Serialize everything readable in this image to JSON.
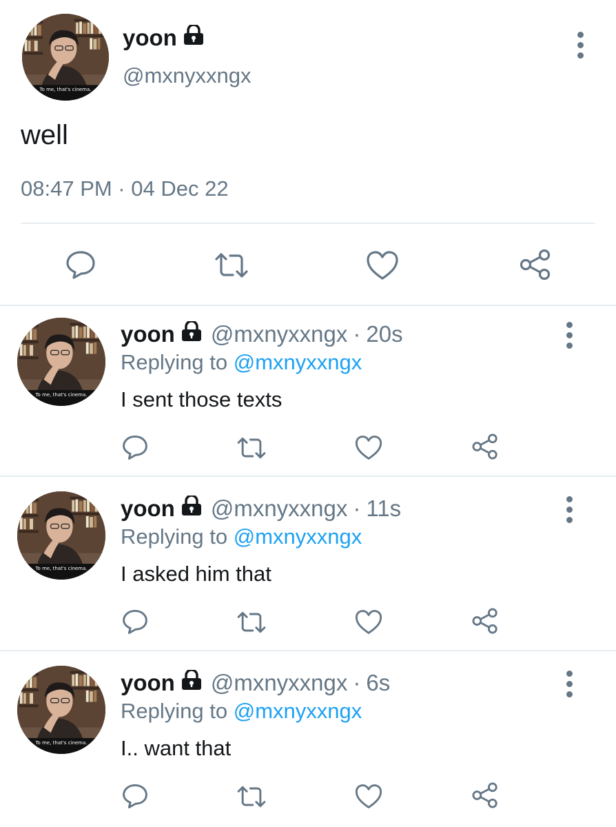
{
  "main_tweet": {
    "display_name": "yoon",
    "handle": "@mxnyxxngx",
    "text": "well",
    "timestamp": "08:47 PM · 04 Dec 22",
    "avatar_caption": "To me, that's cinema.",
    "icons": {
      "protected": "lock-icon",
      "more": "more-vertical-icon",
      "reply": "reply-icon",
      "retweet": "retweet-icon",
      "like": "heart-icon",
      "share": "share-icon"
    }
  },
  "replies": [
    {
      "display_name": "yoon",
      "handle": "@mxnyxxngx",
      "separator": "·",
      "time": "20s",
      "replying_prefix": "Replying to ",
      "replying_to": "@mxnyxxngx",
      "text": "I sent those texts",
      "avatar_caption": "To me, that's cinema."
    },
    {
      "display_name": "yoon",
      "handle": "@mxnyxxngx",
      "separator": "·",
      "time": "11s",
      "replying_prefix": "Replying to ",
      "replying_to": "@mxnyxxngx",
      "text": "I asked him that",
      "avatar_caption": "To me, that's cinema."
    },
    {
      "display_name": "yoon",
      "handle": "@mxnyxxngx",
      "separator": "·",
      "time": "6s",
      "replying_prefix": "Replying to ",
      "replying_to": "@mxnyxxngx",
      "text": "I.. want that",
      "avatar_caption": "To me, that's cinema."
    }
  ],
  "colors": {
    "text_primary": "#14171a",
    "text_secondary": "#657786",
    "link": "#1da1f2",
    "divider": "#e6ecf0"
  }
}
